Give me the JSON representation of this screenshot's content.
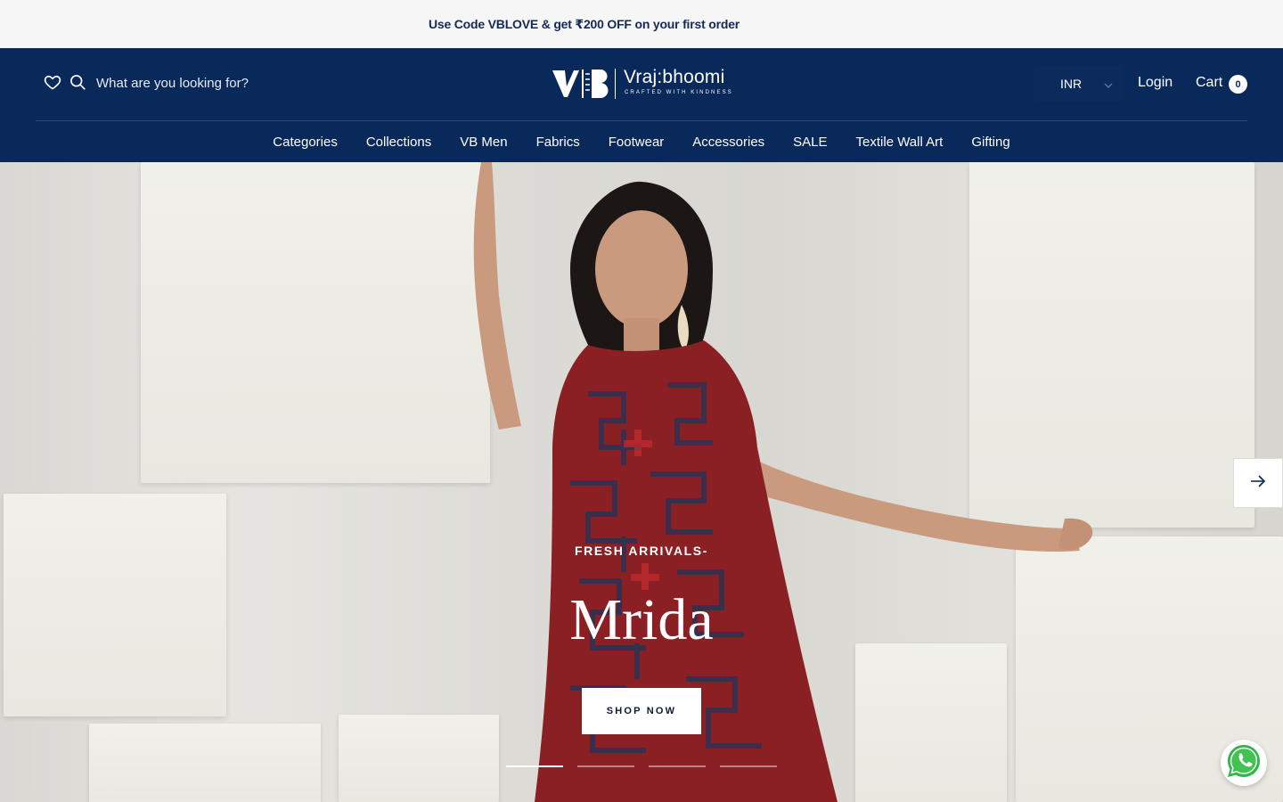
{
  "announcement": {
    "text": "Use Code VBLOVE & get ₹200 OFF on your first order"
  },
  "header": {
    "search_placeholder": "What are you looking for?",
    "logo": {
      "name": "Vraj:bhoomi",
      "tagline": "CRAFTED WITH KINDNESS"
    },
    "currency": "INR",
    "login_label": "Login",
    "cart_label": "Cart",
    "cart_count": "0"
  },
  "nav": {
    "items": [
      {
        "label": "Categories"
      },
      {
        "label": "Collections"
      },
      {
        "label": "VB Men"
      },
      {
        "label": "Fabrics"
      },
      {
        "label": "Footwear"
      },
      {
        "label": "Accessories"
      },
      {
        "label": "SALE"
      },
      {
        "label": "Textile Wall Art"
      },
      {
        "label": "Gifting"
      }
    ]
  },
  "hero": {
    "eyebrow": "FRESH ARRIVALS-",
    "title": "Mrida",
    "cta_label": "SHOP NOW",
    "slide_count": 4,
    "active_slide": 1
  },
  "colors": {
    "header_bg": "#08295a",
    "announce_bg": "#f6f6f6",
    "accent_red": "#8a1f24"
  },
  "icons": [
    "heart-icon",
    "search-icon",
    "chevron-down-icon",
    "arrow-right-icon",
    "whatsapp-icon"
  ]
}
